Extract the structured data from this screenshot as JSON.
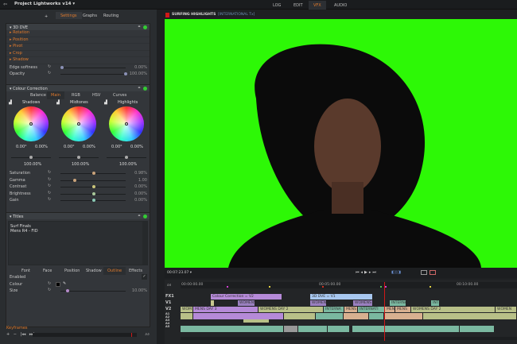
{
  "app": {
    "title": "Project Lightworks v14 ▾",
    "exit_icon": "exit-icon"
  },
  "nav": {
    "tabs": [
      "LOG",
      "EDIT",
      "VFX",
      "AUDIO"
    ],
    "active": "VFX"
  },
  "left_tabs": {
    "add": "+",
    "tabs": [
      "Settings",
      "Graphs",
      "Routing"
    ],
    "active": "Settings"
  },
  "dve": {
    "title": "3D DVE",
    "sections": [
      "Rotation",
      "Position",
      "Pivot",
      "Crop",
      "Shadow"
    ],
    "rows": [
      {
        "label": "Edge softness",
        "value": "0.00%",
        "level": 0
      },
      {
        "label": "Opacity",
        "value": "100.00%",
        "level": 1
      }
    ]
  },
  "cc": {
    "title": "Colour Correction",
    "tabs": [
      "Balance",
      "Main",
      "RGB",
      "HSV",
      "Curves"
    ],
    "active": "Main",
    "wheels": [
      {
        "name": "Shadows",
        "hue": "0.00°",
        "sat": "0.00%",
        "lum": "100.00%"
      },
      {
        "name": "Midtones",
        "hue": "0.00°",
        "sat": "0.00%",
        "lum": "100.00%"
      },
      {
        "name": "Highlights",
        "hue": "0.00°",
        "sat": "0.00%",
        "lum": "100.00%"
      }
    ],
    "rows": [
      {
        "label": "Saturation",
        "value": "0.98%",
        "level": 0.5,
        "color": "#c9a27a"
      },
      {
        "label": "Gamma",
        "value": "1.00",
        "level": 0.2,
        "color": "#c9a27a"
      },
      {
        "label": "Contrast",
        "value": "0.00%",
        "level": 0.5,
        "color": "#c9c47a"
      },
      {
        "label": "Brightness",
        "value": "0.00%",
        "level": 0.5,
        "color": "#a9c99a"
      },
      {
        "label": "Gain",
        "value": "0.00%",
        "level": 0.5,
        "color": "#8ac9b5"
      }
    ]
  },
  "titles": {
    "title": "Titles",
    "text_line1": "Surf Finals",
    "text_line2": "Mens R4 - FID",
    "tabs": [
      "Font",
      "Face",
      "Position",
      "Shadow",
      "Outline",
      "Effects"
    ],
    "active": "Outline",
    "rows": [
      {
        "label": "Enabled"
      },
      {
        "label": "Colour"
      },
      {
        "label": "Size",
        "value": "10.00%",
        "level": 0.1
      }
    ]
  },
  "keyframes": {
    "label": "Keyframes",
    "controls": [
      "+",
      "−",
      "|◂◂",
      "▸▸|"
    ]
  },
  "viewer": {
    "title": "SURFING HIGHLIGHTS",
    "subtitle": "[INTERNATIONAL Tx]",
    "timecode": "00:07:23.07 ▾"
  },
  "timeline": {
    "ruler": [
      "00:00:00.00",
      "00:05:00.00",
      "00:10:00.00"
    ],
    "tracks": [
      "FX1",
      "V1",
      "V2",
      "A1",
      "A2",
      "A3",
      "A4",
      "A5"
    ],
    "clips": {
      "cc": "Colour Correction = V2",
      "dve": "3D DVE = V1",
      "womens": "WOMENS",
      "womens1": "WOMEN",
      "inter": "INTERNA",
      "int": "INT",
      "mens3": "MENS DAY 3",
      "womens2": "WOMENS DAY 2",
      "intern": "INTERNATI",
      "mens": "MENS",
      "wom": "WOM",
      "womensday2b": "WOMENS DAY 2",
      "womensend": "WOMEN"
    }
  },
  "colors": {
    "accent": "#e07a2c",
    "green_screen": "#2df806",
    "playhead": "#d01818"
  }
}
